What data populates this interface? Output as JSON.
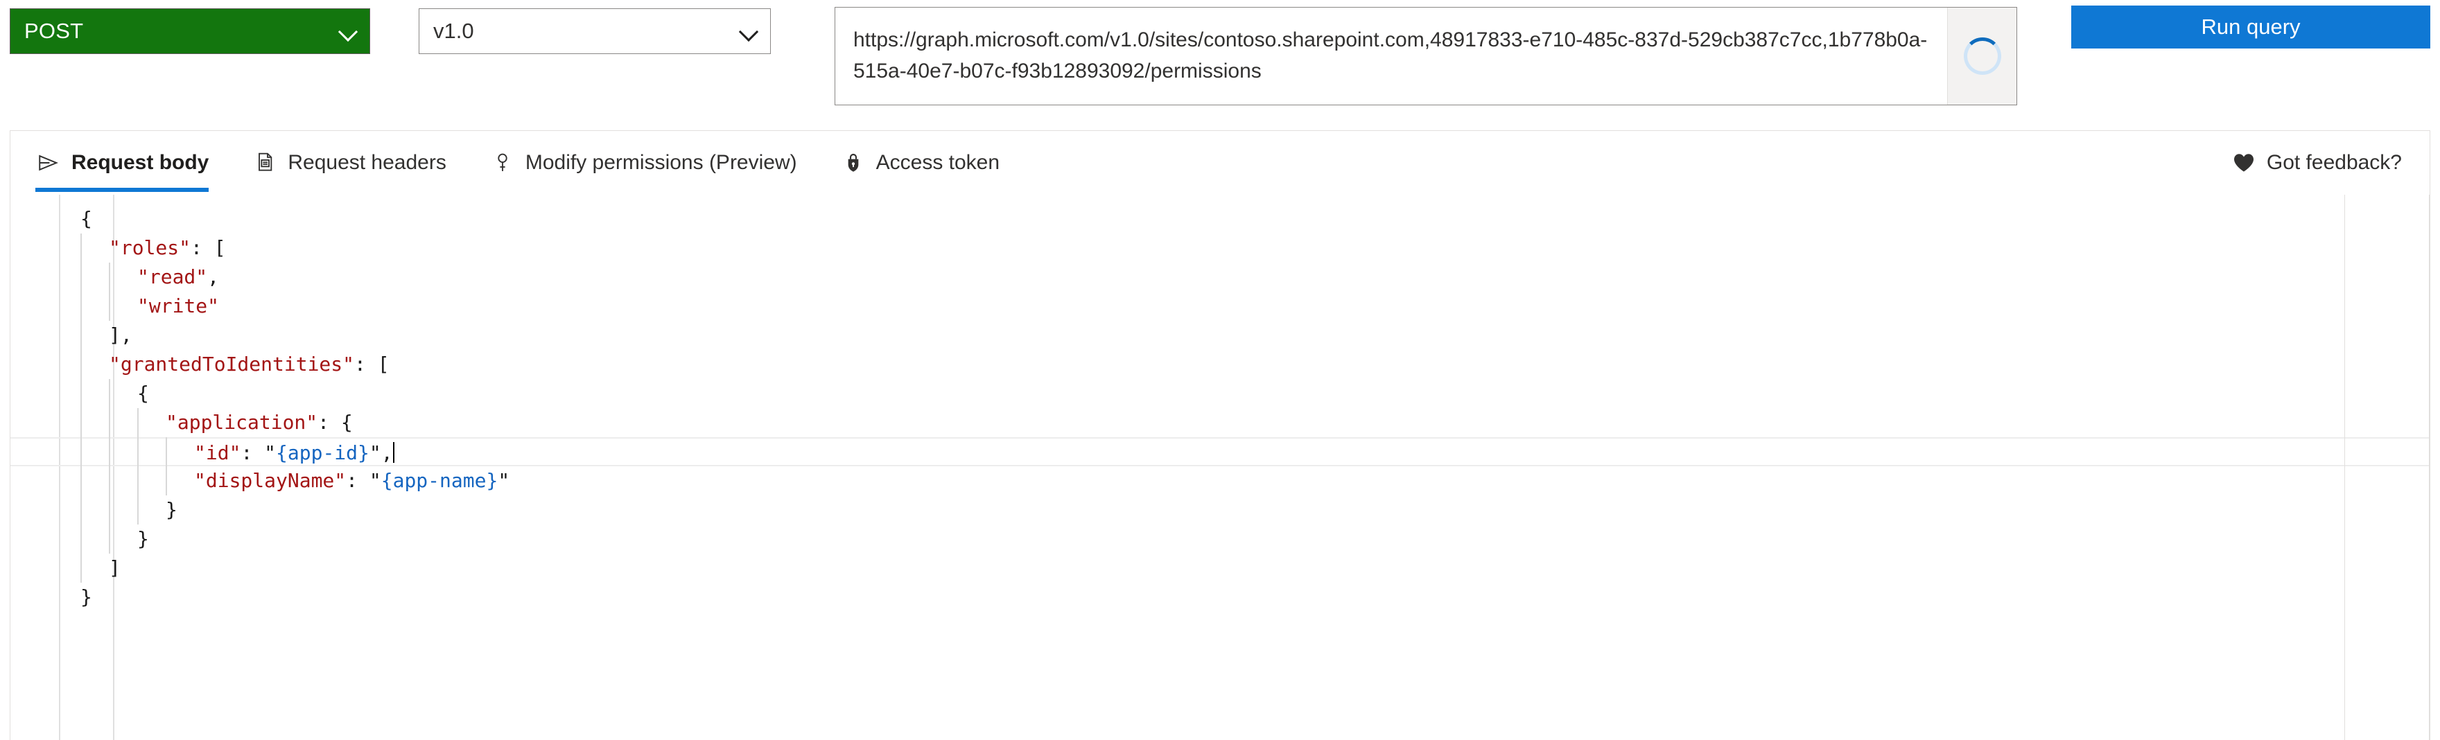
{
  "colors": {
    "method_bg": "#13760e",
    "accent": "#0f78d4",
    "json_key": "#a31515",
    "json_string": "#1565c0",
    "json_punct": "#1a1a1a"
  },
  "query_bar": {
    "method": {
      "value": "POST",
      "chevron_icon": "chevron-down-icon"
    },
    "version": {
      "value": "v1.0",
      "chevron_icon": "chevron-down-icon"
    },
    "url": {
      "value": "https://graph.microsoft.com/v1.0/sites/contoso.sharepoint.com,48917833-e710-485c-837d-529cb387c7cc,1b778b0a-515a-40e7-b07c-f93b12893092/permissions",
      "loading_icon": "spinner-icon"
    },
    "run_query_label": "Run query"
  },
  "tabs": [
    {
      "label": "Request body",
      "icon": "send-arrow-icon",
      "active": true
    },
    {
      "label": "Request headers",
      "icon": "document-list-icon",
      "active": false
    },
    {
      "label": "Modify permissions (Preview)",
      "icon": "key-icon",
      "active": false
    },
    {
      "label": "Access token",
      "icon": "lock-shield-icon",
      "active": false
    }
  ],
  "feedback": {
    "label": "Got feedback?",
    "icon": "heart-icon"
  },
  "editor": {
    "lines": [
      {
        "indent": 0,
        "tokens": [
          {
            "t": "pun",
            "v": "{"
          }
        ]
      },
      {
        "indent": 1,
        "tokens": [
          {
            "t": "key",
            "v": "\"roles\""
          },
          {
            "t": "pun",
            "v": ": ["
          }
        ]
      },
      {
        "indent": 2,
        "tokens": [
          {
            "t": "key",
            "v": "\"read\""
          },
          {
            "t": "pun",
            "v": ","
          }
        ]
      },
      {
        "indent": 2,
        "tokens": [
          {
            "t": "key",
            "v": "\"write\""
          }
        ]
      },
      {
        "indent": 1,
        "tokens": [
          {
            "t": "pun",
            "v": "],"
          }
        ]
      },
      {
        "indent": 1,
        "tokens": [
          {
            "t": "key",
            "v": "\"grantedToIdentities\""
          },
          {
            "t": "pun",
            "v": ": ["
          }
        ]
      },
      {
        "indent": 2,
        "tokens": [
          {
            "t": "pun",
            "v": "{"
          }
        ]
      },
      {
        "indent": 3,
        "tokens": [
          {
            "t": "key",
            "v": "\"application\""
          },
          {
            "t": "pun",
            "v": ": {"
          }
        ]
      },
      {
        "indent": 4,
        "current": true,
        "caret": true,
        "tokens": [
          {
            "t": "key",
            "v": "\"id\""
          },
          {
            "t": "pun",
            "v": ": "
          },
          {
            "t": "pun",
            "v": "\""
          },
          {
            "t": "str",
            "v": "{app-id}"
          },
          {
            "t": "pun",
            "v": "\","
          }
        ]
      },
      {
        "indent": 4,
        "tokens": [
          {
            "t": "key",
            "v": "\"displayName\""
          },
          {
            "t": "pun",
            "v": ": "
          },
          {
            "t": "pun",
            "v": "\""
          },
          {
            "t": "str",
            "v": "{app-name}"
          },
          {
            "t": "pun",
            "v": "\""
          }
        ]
      },
      {
        "indent": 3,
        "tokens": [
          {
            "t": "pun",
            "v": "}"
          }
        ]
      },
      {
        "indent": 2,
        "tokens": [
          {
            "t": "pun",
            "v": "}"
          }
        ]
      },
      {
        "indent": 1,
        "tokens": [
          {
            "t": "pun",
            "v": "]"
          }
        ]
      },
      {
        "indent": 0,
        "tokens": [
          {
            "t": "pun",
            "v": "}"
          }
        ]
      }
    ]
  }
}
